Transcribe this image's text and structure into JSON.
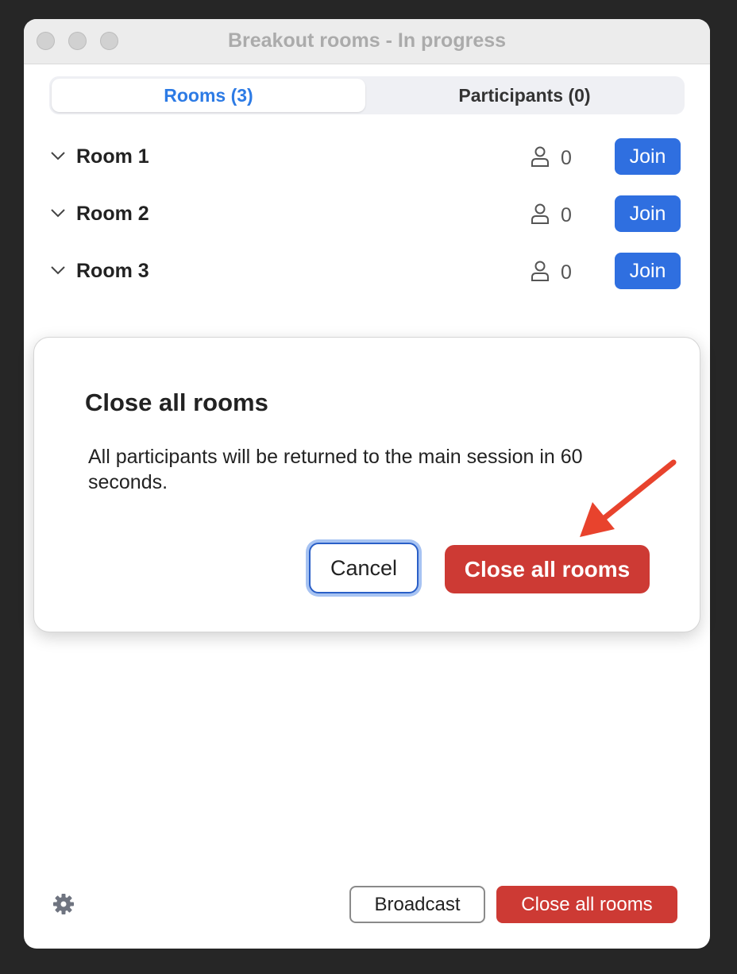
{
  "window": {
    "title": "Breakout rooms - In progress"
  },
  "tabs": [
    {
      "label": "Rooms (3)",
      "active": true
    },
    {
      "label": "Participants (0)",
      "active": false
    }
  ],
  "rooms": [
    {
      "name": "Room 1",
      "count": "0",
      "join_label": "Join"
    },
    {
      "name": "Room 2",
      "count": "0",
      "join_label": "Join"
    },
    {
      "name": "Room 3",
      "count": "0",
      "join_label": "Join"
    }
  ],
  "dialog": {
    "title": "Close all rooms",
    "message": "All participants will be returned to the main session in 60 seconds.",
    "cancel_label": "Cancel",
    "confirm_label": "Close all rooms"
  },
  "footer": {
    "broadcast_label": "Broadcast",
    "close_all_label": "Close all rooms"
  },
  "icons": {
    "room_chevron": "chevron-down-icon",
    "participants": "person-icon",
    "settings": "gear-icon",
    "annotation": "arrow-icon"
  },
  "colors": {
    "accent_blue": "#2f6fe0",
    "danger_red": "#cd3a34",
    "annotation_arrow": "#e8432d"
  }
}
